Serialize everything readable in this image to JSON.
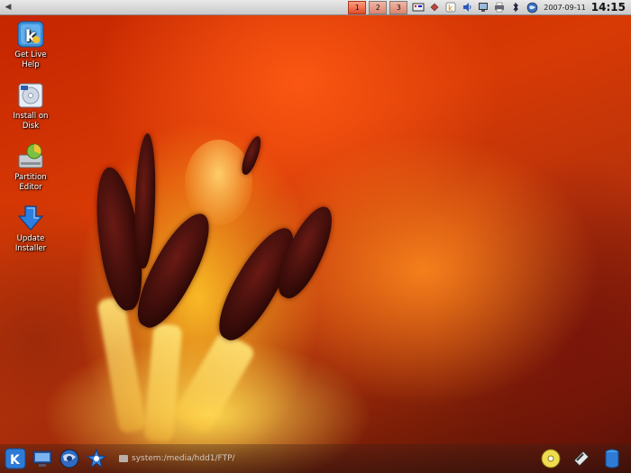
{
  "top_panel": {
    "menu_icon": "menu-arrow-icon",
    "desktops": [
      "1",
      "2",
      "3"
    ],
    "active_desktop": "1",
    "tray_icons": [
      "keyboard-layout-icon",
      "clipboard-icon",
      "kde-icon",
      "volume-icon",
      "network-monitor-icon",
      "printer-icon",
      "bluetooth-icon",
      "globe-icon"
    ],
    "date": "2007-09-11",
    "time": "14:15"
  },
  "desktop_icons": [
    {
      "label": "Get Live\nHelp",
      "icon": "help-book-icon"
    },
    {
      "label": "Install on\nDisk",
      "icon": "install-disk-icon"
    },
    {
      "label": "Partition\nEditor",
      "icon": "partition-editor-icon"
    },
    {
      "label": "Update\nInstaller",
      "icon": "update-arrow-icon"
    }
  ],
  "bottom_panel": {
    "launchers": [
      "kde-menu-icon",
      "desktop-icon",
      "browser-globe-icon",
      "network-star-icon"
    ],
    "path": "system:/media/hdd1/FTP/",
    "right_launchers": [
      "cd-icon",
      "storage-icon",
      "database-icon"
    ]
  },
  "colors": {
    "accent": "#e04a28",
    "panel": "#d9d9d9"
  }
}
